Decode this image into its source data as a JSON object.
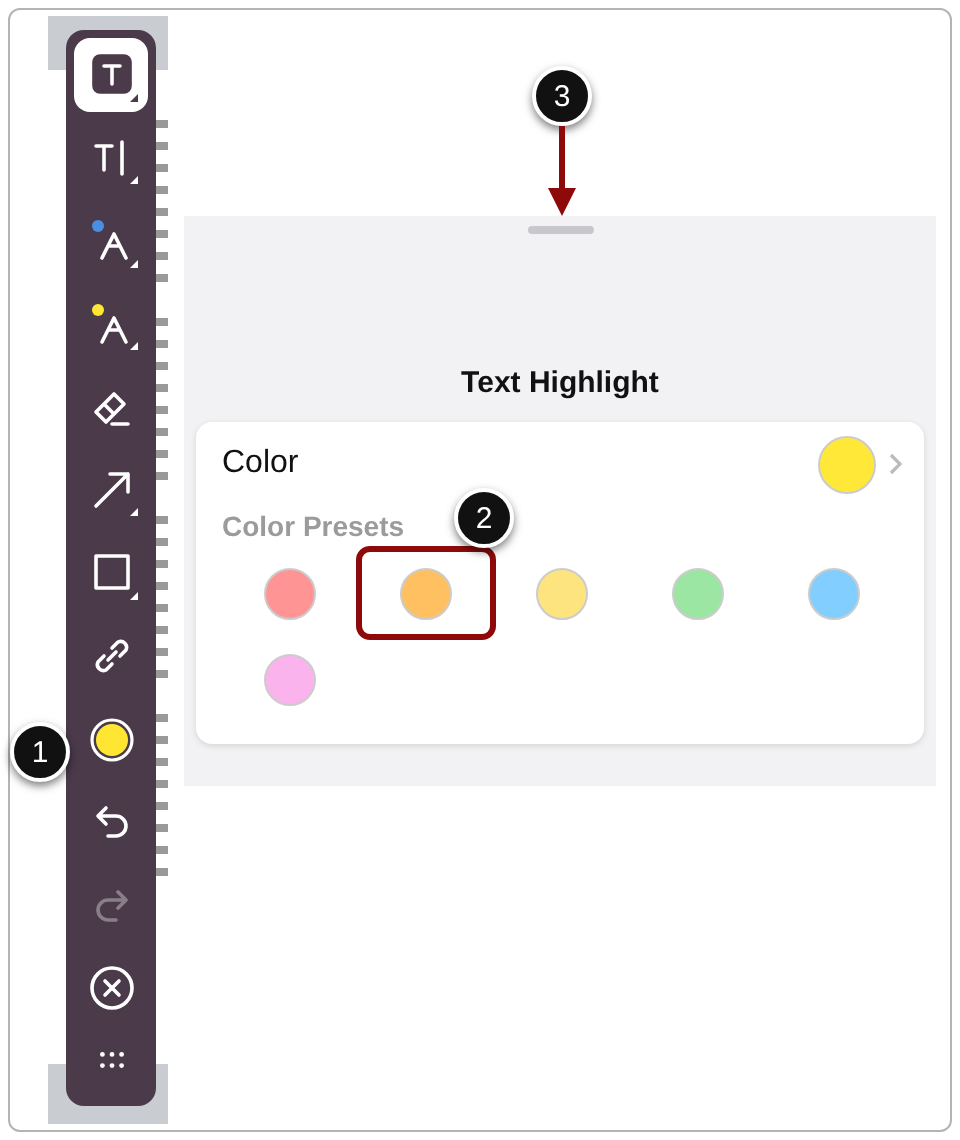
{
  "toolbar": {
    "tools": [
      {
        "kind": "text-box",
        "selected": true,
        "disabled": false
      },
      {
        "kind": "text-cursor",
        "selected": false,
        "disabled": false
      },
      {
        "kind": "pen",
        "color": "#4a90e2",
        "selected": false,
        "disabled": false
      },
      {
        "kind": "pen",
        "color": "#ffe632",
        "selected": false,
        "disabled": false
      },
      {
        "kind": "eraser",
        "selected": false,
        "disabled": false
      },
      {
        "kind": "arrow",
        "selected": false,
        "disabled": false
      },
      {
        "kind": "square",
        "selected": false,
        "disabled": false
      },
      {
        "kind": "link",
        "selected": false,
        "disabled": false
      },
      {
        "kind": "color",
        "color": "#ffe632",
        "selected": false,
        "disabled": false
      },
      {
        "kind": "undo",
        "selected": false,
        "disabled": false
      },
      {
        "kind": "redo",
        "selected": false,
        "disabled": true
      },
      {
        "kind": "close",
        "selected": false,
        "disabled": false
      },
      {
        "kind": "grip",
        "selected": false,
        "disabled": false
      }
    ]
  },
  "panel": {
    "title": "Text Highlight",
    "color_label": "Color",
    "color": "#ffe838",
    "presets_label": "Color Presets",
    "presets": [
      {
        "color": "#ff9494",
        "outlined": false
      },
      {
        "color": "#ffc062",
        "outlined": true
      },
      {
        "color": "#fde47e",
        "outlined": false
      },
      {
        "color": "#9ce6a3",
        "outlined": false
      },
      {
        "color": "#82cfff",
        "outlined": false
      },
      {
        "color": "#fbb3ee",
        "outlined": false
      }
    ]
  },
  "callouts": [
    {
      "number": "1"
    },
    {
      "number": "2"
    },
    {
      "number": "3"
    }
  ]
}
